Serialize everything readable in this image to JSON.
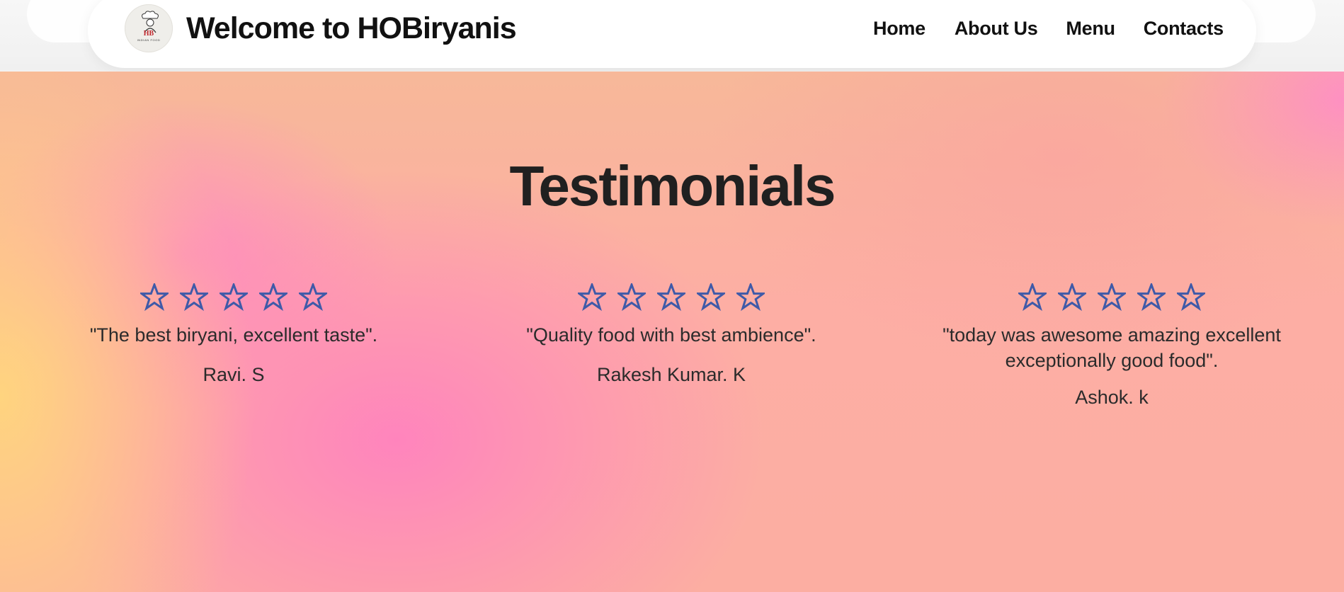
{
  "header": {
    "title": "Welcome to HOBiryanis",
    "logo": {
      "icon": "chef-logo-icon",
      "text_top": "HB",
      "text_bottom": "INDIAN FOOD"
    },
    "nav": [
      {
        "label": "Home"
      },
      {
        "label": "About Us"
      },
      {
        "label": "Menu"
      },
      {
        "label": "Contacts"
      }
    ]
  },
  "testimonials": {
    "heading": "Testimonials",
    "star_color": "#3f5aa8",
    "items": [
      {
        "rating_stars": 5,
        "quote": "\"The best biryani, excellent taste\".",
        "author": "Ravi. S"
      },
      {
        "rating_stars": 5,
        "quote": "\"Quality food with best ambience\".",
        "author": "Rakesh Kumar. K"
      },
      {
        "rating_stars": 5,
        "quote": "\"today was awesome amazing excellent exceptionally good food\".",
        "author": "Ashok. k"
      }
    ]
  }
}
